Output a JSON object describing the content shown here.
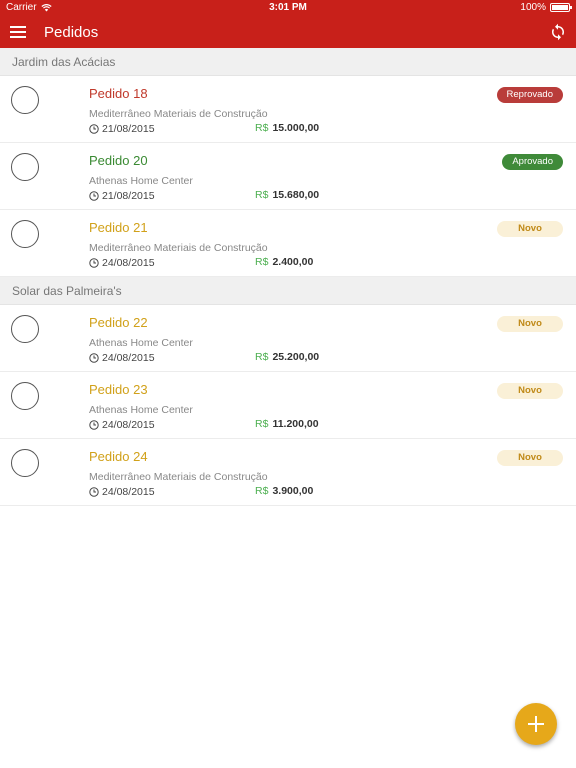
{
  "status": {
    "carrier": "Carrier",
    "time": "3:01 PM",
    "battery": "100%"
  },
  "header": {
    "title": "Pedidos"
  },
  "sections": [
    {
      "title": "Jardim das Acácias",
      "orders": [
        {
          "title": "Pedido 18",
          "status": "Reprovado",
          "supplier": "Mediterrâneo Materiais de Construção",
          "date": "21/08/2015",
          "currency": "R$",
          "amount": "15.000,00"
        },
        {
          "title": "Pedido 20",
          "status": "Aprovado",
          "supplier": "Athenas Home Center",
          "date": "21/08/2015",
          "currency": "R$",
          "amount": "15.680,00"
        },
        {
          "title": "Pedido 21",
          "status": "Novo",
          "supplier": "Mediterrâneo Materiais de Construção",
          "date": "24/08/2015",
          "currency": "R$",
          "amount": "2.400,00"
        }
      ]
    },
    {
      "title": "Solar das Palmeira's",
      "orders": [
        {
          "title": "Pedido 22",
          "status": "Novo",
          "supplier": "Athenas Home Center",
          "date": "24/08/2015",
          "currency": "R$",
          "amount": "25.200,00"
        },
        {
          "title": "Pedido 23",
          "status": "Novo",
          "supplier": "Athenas Home Center",
          "date": "24/08/2015",
          "currency": "R$",
          "amount": "11.200,00"
        },
        {
          "title": "Pedido 24",
          "status": "Novo",
          "supplier": "Mediterrâneo Materiais de Construção",
          "date": "24/08/2015",
          "currency": "R$",
          "amount": "3.900,00"
        }
      ]
    }
  ],
  "colors": {
    "primary": "#c8201a",
    "fab": "#e6a81a",
    "reprovado": "#b93c3a",
    "aprovado": "#3f8a39",
    "novo": "#d1a11a"
  },
  "icons": {
    "menu": "hamburger-icon",
    "sync": "sync-icon",
    "clock": "clock-icon",
    "fab": "plus-icon",
    "wifi": "wifi-icon",
    "battery": "battery-icon"
  }
}
